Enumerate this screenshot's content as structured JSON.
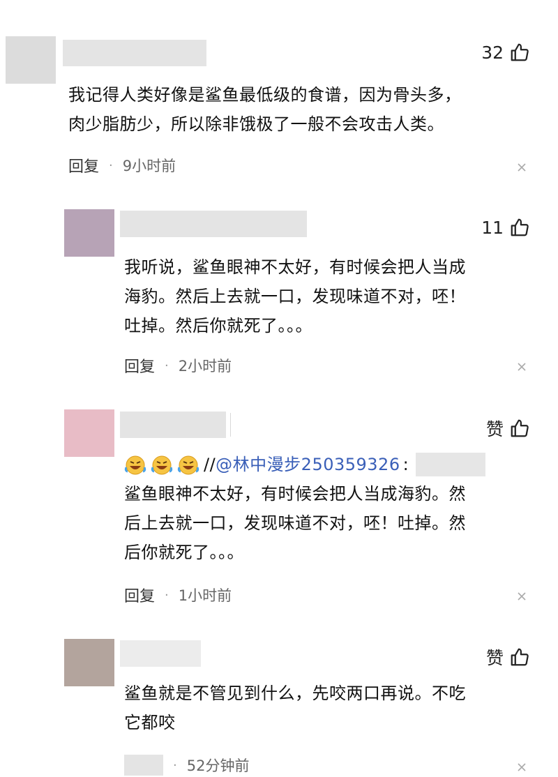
{
  "comments": [
    {
      "likes": "32",
      "text_lines": [
        "我记得人类好像是鲨鱼最低级的食谱，因为骨头多，",
        "肉少脂肪少，所以除非饿极了一般不会攻击人类。"
      ],
      "reply_label": "回复",
      "time": "9小时前",
      "avatar_color": "#dcdcdc"
    },
    {
      "likes": "11",
      "text_lines": [
        "我听说，鲨鱼眼神不太好，有时候会把人当成",
        "海豹。然后上去就一口，发现味道不对，呸！",
        "吐掉。然后你就死了。。。"
      ],
      "reply_label": "回复",
      "time": "2小时前",
      "avatar_color": "#b7a3b6"
    },
    {
      "likes": "赞",
      "mention_prefix": "//",
      "mention": "@林中漫步250359326",
      "mention_colon": ":",
      "text_lines": [
        "鲨鱼眼神不太好，有时候会把人当成海豹。然",
        "后上去就一口，发现味道不对，呸！吐掉。然",
        "后你就死了。。。"
      ],
      "reply_label": "回复",
      "time": "1小时前",
      "avatar_color": "#e8bcc6"
    },
    {
      "likes": "赞",
      "text_lines": [
        "鲨鱼就是不管见到什么，先咬两口再说。不吃",
        "它都咬"
      ],
      "time": "52分钟前",
      "avatar_color": "#b3a49d"
    }
  ],
  "icons": {
    "like": "thumbs-up-icon",
    "close": "close-icon",
    "emoji": "laughing-crying-emoji-icon"
  }
}
